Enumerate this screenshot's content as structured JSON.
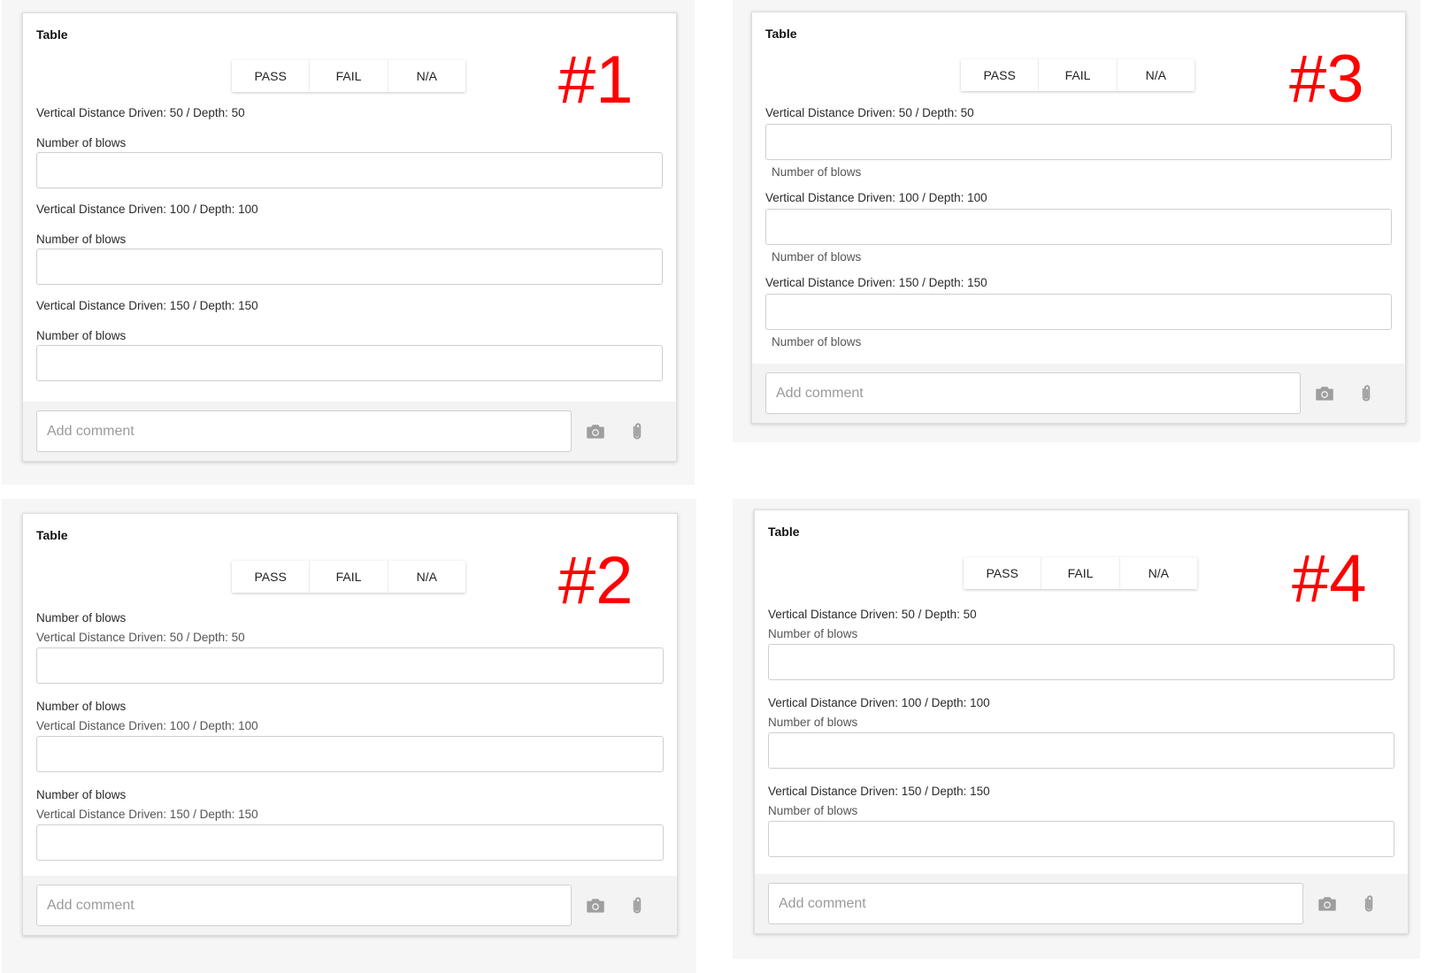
{
  "cards": [
    {
      "title": "Table",
      "badge": "#1",
      "buttons": [
        "PASS",
        "FAIL",
        "N/A"
      ],
      "rows": [
        {
          "distance": "Vertical Distance Driven: 50 / Depth: 50",
          "blows": "Number of blows"
        },
        {
          "distance": "Vertical Distance Driven: 100 / Depth: 100",
          "blows": "Number of blows"
        },
        {
          "distance": "Vertical Distance Driven: 150 / Depth: 150",
          "blows": "Number of blows"
        }
      ],
      "comment_placeholder": "Add comment"
    },
    {
      "title": "Table",
      "badge": "#2",
      "buttons": [
        "PASS",
        "FAIL",
        "N/A"
      ],
      "rows": [
        {
          "distance": "Vertical Distance Driven: 50 / Depth: 50",
          "blows": "Number of blows"
        },
        {
          "distance": "Vertical Distance Driven: 100 / Depth: 100",
          "blows": "Number of blows"
        },
        {
          "distance": "Vertical Distance Driven: 150 / Depth: 150",
          "blows": "Number of blows"
        }
      ],
      "comment_placeholder": "Add comment"
    },
    {
      "title": "Table",
      "badge": "#3",
      "buttons": [
        "PASS",
        "FAIL",
        "N/A"
      ],
      "rows": [
        {
          "distance": "Vertical Distance Driven: 50 / Depth: 50",
          "blows": "Number of blows"
        },
        {
          "distance": "Vertical Distance Driven: 100 / Depth: 100",
          "blows": "Number of blows"
        },
        {
          "distance": "Vertical Distance Driven: 150 / Depth: 150",
          "blows": "Number of blows"
        }
      ],
      "comment_placeholder": "Add comment"
    },
    {
      "title": "Table",
      "badge": "#4",
      "buttons": [
        "PASS",
        "FAIL",
        "N/A"
      ],
      "rows": [
        {
          "distance": "Vertical Distance Driven: 50 / Depth: 50",
          "blows": "Number of blows"
        },
        {
          "distance": "Vertical Distance Driven: 100 / Depth: 100",
          "blows": "Number of blows"
        },
        {
          "distance": "Vertical Distance Driven: 150 / Depth: 150",
          "blows": "Number of blows"
        }
      ],
      "comment_placeholder": "Add comment"
    }
  ],
  "icons": {
    "camera": "camera-icon",
    "attach": "paperclip-icon"
  },
  "colors": {
    "badge": "#ff0000",
    "footer": "#f3f3f3"
  }
}
